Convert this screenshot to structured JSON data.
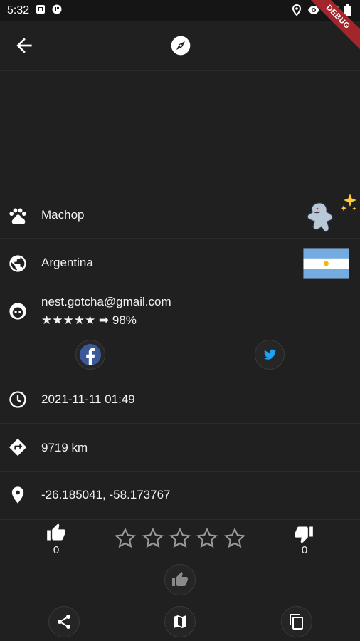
{
  "status_bar": {
    "time": "5:32",
    "debug_label": "DEBUG"
  },
  "pokemon": {
    "name": "Machop",
    "shiny_icon": "sparkles-icon"
  },
  "country": {
    "name": "Argentina",
    "flag": "argentina-flag"
  },
  "trainer": {
    "email": "nest.gotcha@gmail.com",
    "reputation": "★★★★★ ➡ 98%"
  },
  "social": {
    "facebook": "facebook-icon",
    "twitter": "twitter-icon"
  },
  "details": {
    "datetime": "2021-11-11 01:49",
    "distance": "9719 km",
    "coordinates": "-26.185041, -58.173767"
  },
  "votes": {
    "likes": "0",
    "dislikes": "0",
    "stars_total": 5,
    "stars_filled": 0
  },
  "colors": {
    "background": "#202020",
    "facebook": "#3b5998",
    "twitter": "#1da1f2",
    "flag_blue": "#74acdf",
    "sun": "#f6b40e"
  }
}
